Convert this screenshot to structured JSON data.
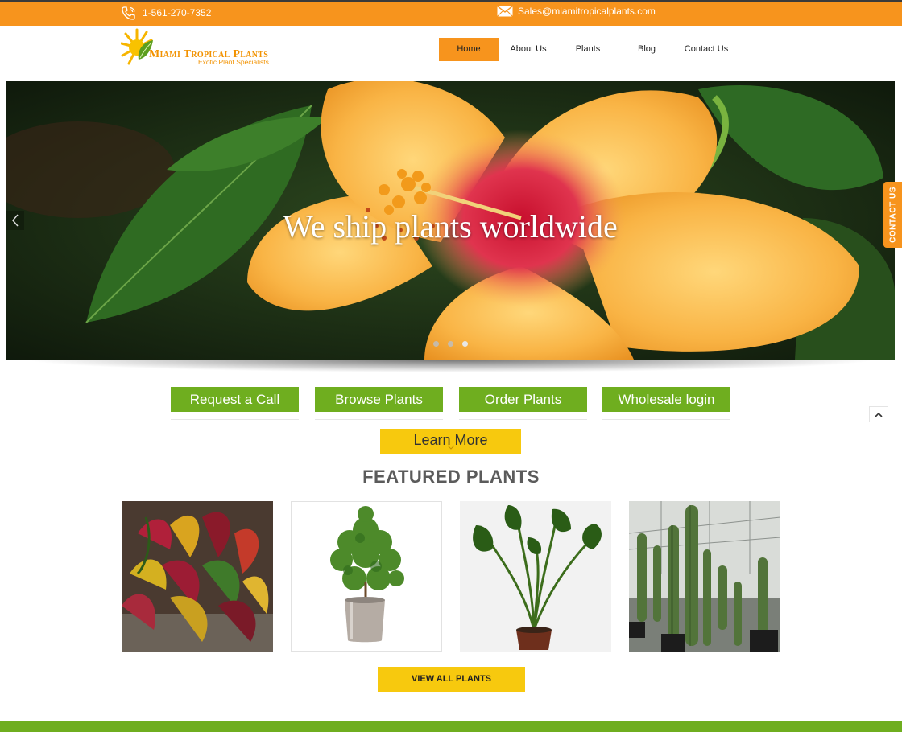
{
  "topbar": {
    "phone": "1-561-270-7352",
    "email": "Sales@miamitropicalplants.com",
    "bg_color": "#f7941d"
  },
  "logo": {
    "name": "Miami Tropical Plants",
    "tagline": "Exotic Plant Specialists"
  },
  "nav": {
    "items": [
      {
        "label": "Home",
        "active": true
      },
      {
        "label": "About Us"
      },
      {
        "label": "Plants"
      },
      {
        "label": "Blog"
      },
      {
        "label": "Contact Us"
      }
    ]
  },
  "hero": {
    "title": "We ship plants worldwide",
    "slide_count": 3,
    "active_slide": 3
  },
  "contact_tab": "CONTACT US",
  "actions": [
    {
      "label": "Request a Call"
    },
    {
      "label": "Browse Plants"
    },
    {
      "label": "Order Plants"
    },
    {
      "label": "Wholesale login"
    }
  ],
  "learn_more": "Learn More",
  "featured": {
    "title": "FEATURED PLANTS",
    "view_all": "VIEW ALL PLANTS"
  },
  "colors": {
    "orange": "#f7941d",
    "green": "#6fae1f",
    "yellow": "#f7c90e"
  }
}
